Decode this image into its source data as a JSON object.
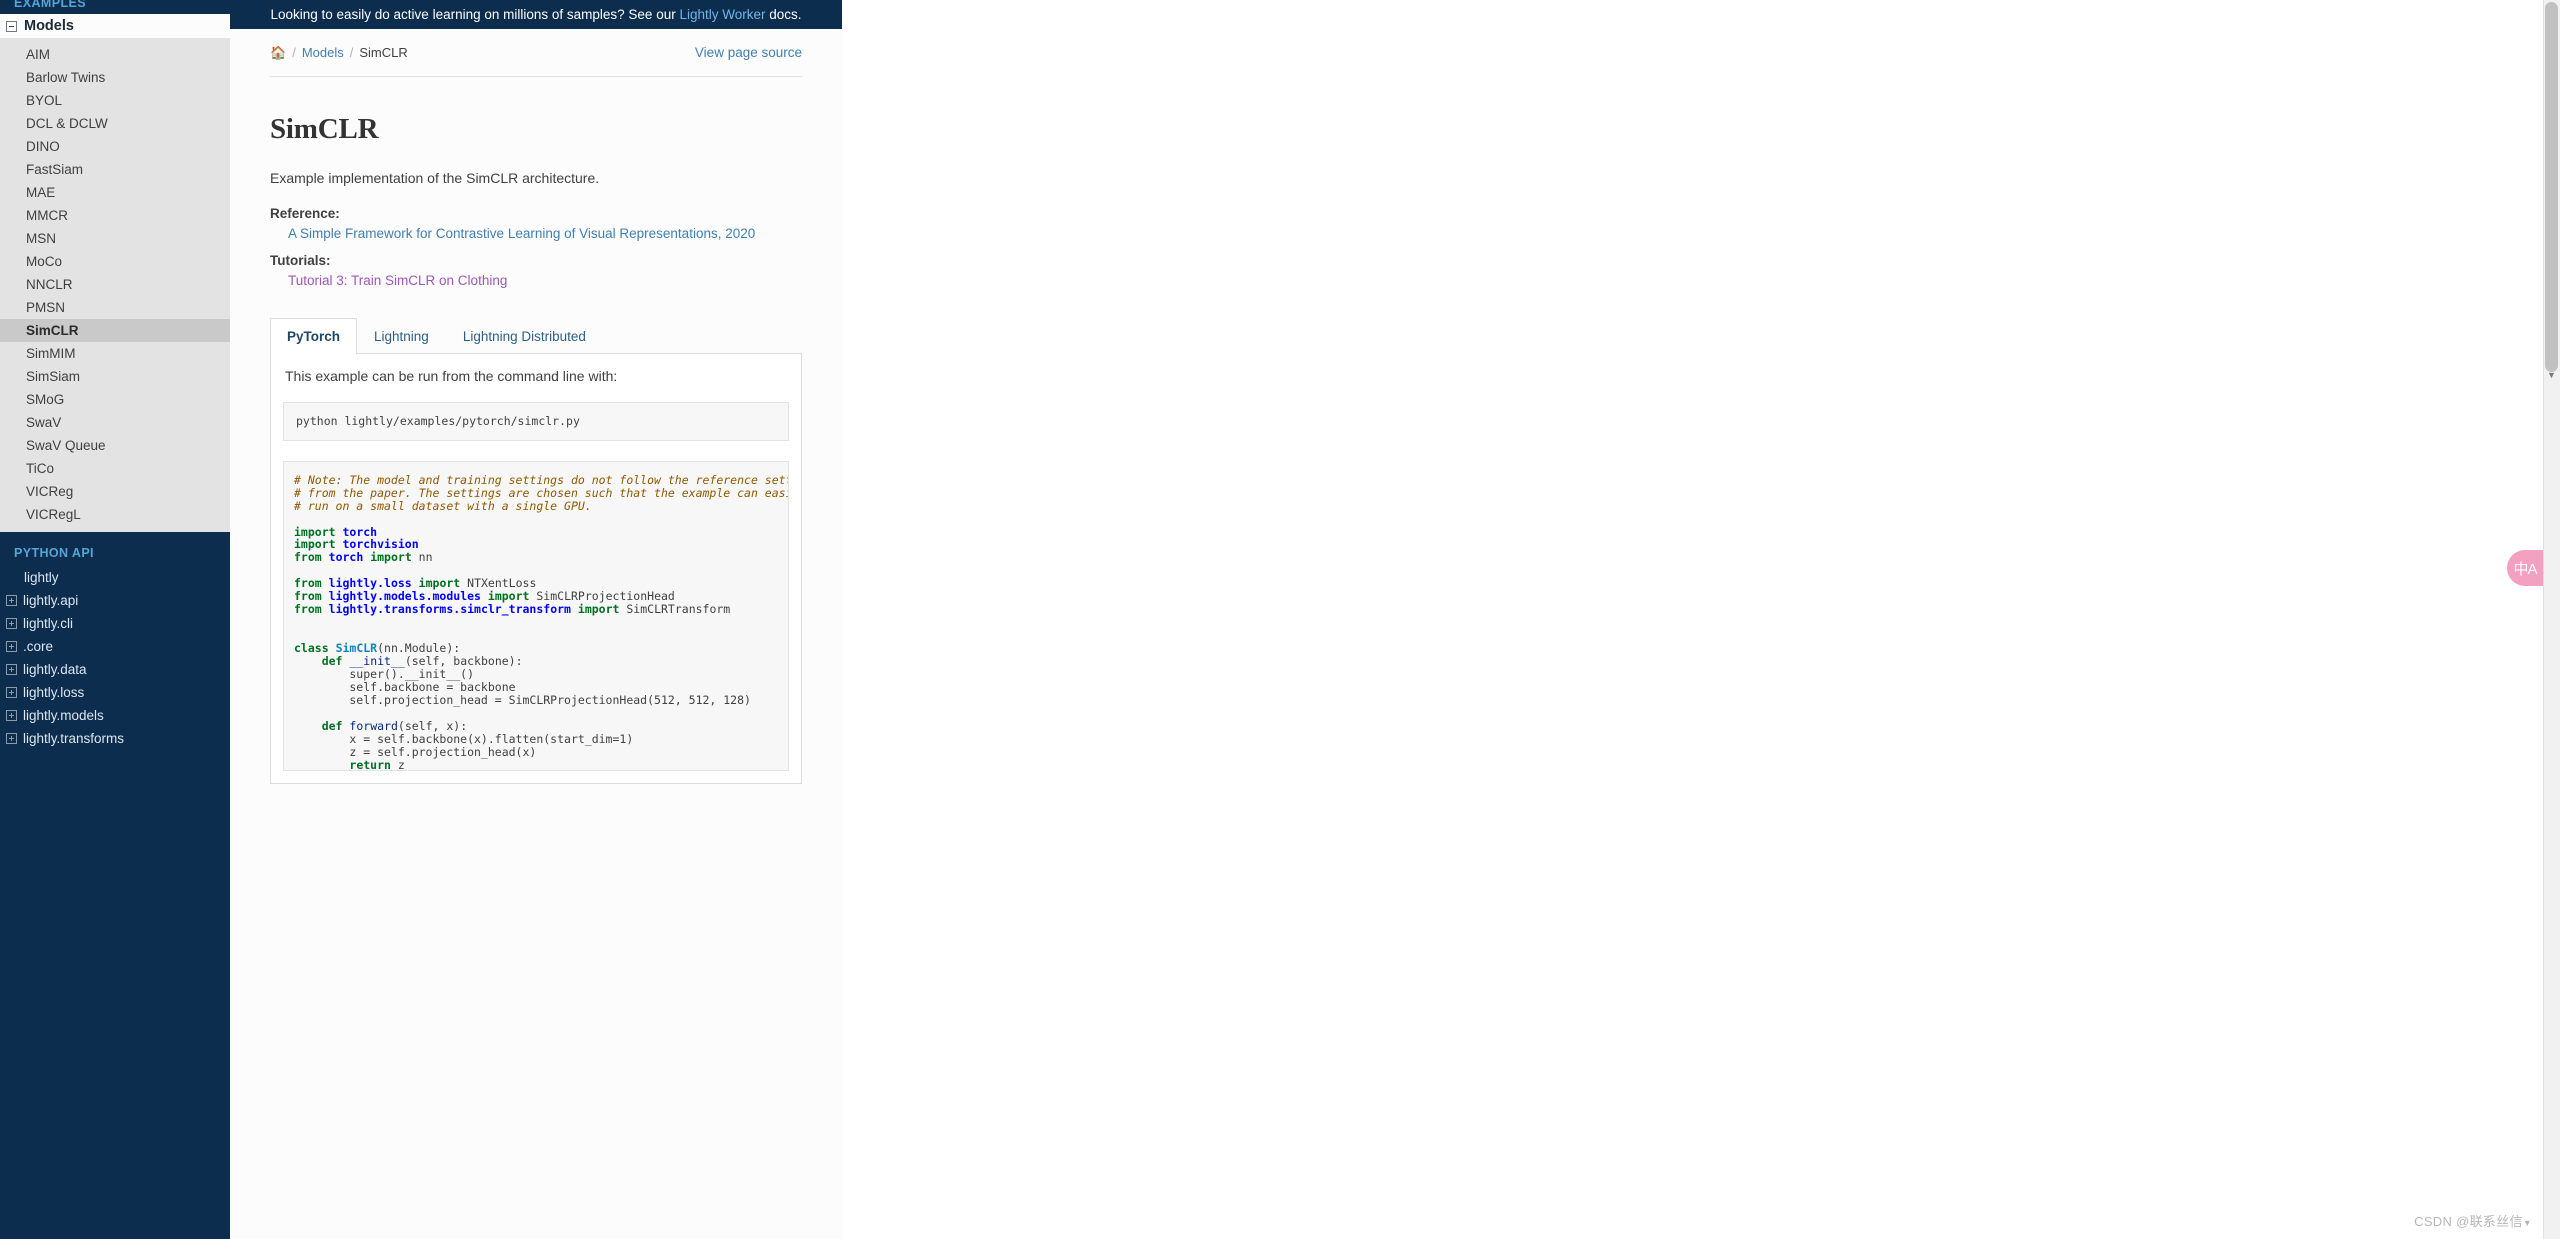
{
  "banner": {
    "text_before": "Looking to easily do active learning on millions of samples? See our ",
    "link_label": "Lightly Worker",
    "text_after": " docs."
  },
  "sidebar": {
    "captions": {
      "examples": "EXAMPLES",
      "python_api": "PYTHON API"
    },
    "models_header": "Models",
    "models": [
      {
        "label": "AIM",
        "active": false
      },
      {
        "label": "Barlow Twins",
        "active": false
      },
      {
        "label": "BYOL",
        "active": false
      },
      {
        "label": "DCL & DCLW",
        "active": false
      },
      {
        "label": "DINO",
        "active": false
      },
      {
        "label": "FastSiam",
        "active": false
      },
      {
        "label": "MAE",
        "active": false
      },
      {
        "label": "MMCR",
        "active": false
      },
      {
        "label": "MSN",
        "active": false
      },
      {
        "label": "MoCo",
        "active": false
      },
      {
        "label": "NNCLR",
        "active": false
      },
      {
        "label": "PMSN",
        "active": false
      },
      {
        "label": "SimCLR",
        "active": true
      },
      {
        "label": "SimMIM",
        "active": false
      },
      {
        "label": "SimSiam",
        "active": false
      },
      {
        "label": "SMoG",
        "active": false
      },
      {
        "label": "SwaV",
        "active": false
      },
      {
        "label": "SwaV Queue",
        "active": false
      },
      {
        "label": "TiCo",
        "active": false
      },
      {
        "label": "VICReg",
        "active": false
      },
      {
        "label": "VICRegL",
        "active": false
      }
    ],
    "python_api": [
      {
        "label": "lightly",
        "expandable": false
      },
      {
        "label": "lightly.api",
        "expandable": true
      },
      {
        "label": "lightly.cli",
        "expandable": true
      },
      {
        "label": ".core",
        "expandable": true
      },
      {
        "label": "lightly.data",
        "expandable": true
      },
      {
        "label": "lightly.loss",
        "expandable": true
      },
      {
        "label": "lightly.models",
        "expandable": true
      },
      {
        "label": "lightly.transforms",
        "expandable": true
      }
    ]
  },
  "breadcrumb": {
    "home_icon": "home-icon",
    "items": [
      {
        "label": "Models",
        "link": true
      },
      {
        "label": "SimCLR",
        "link": false
      }
    ],
    "separator": "/",
    "view_source": "View page source"
  },
  "main": {
    "title": "SimCLR",
    "description": "Example implementation of the SimCLR architecture.",
    "reference_label": "Reference:",
    "reference_link": "A Simple Framework for Contrastive Learning of Visual Representations, 2020",
    "tutorials_label": "Tutorials:",
    "tutorial_link": "Tutorial 3: Train SimCLR on Clothing",
    "tabs": [
      {
        "label": "PyTorch",
        "active": true
      },
      {
        "label": "Lightning",
        "active": false
      },
      {
        "label": "Lightning Distributed",
        "active": false
      }
    ],
    "panel_intro": "This example can be run from the command line with:",
    "command": "python lightly/examples/pytorch/simclr.py",
    "code_lines": [
      {
        "t": "cm",
        "text": "# Note: The model and training settings do not follow the reference settings"
      },
      {
        "t": "cm",
        "text": "# from the paper. The settings are chosen such that the example can easily be"
      },
      {
        "t": "cm",
        "text": "# run on a small dataset with a single GPU."
      },
      {
        "t": "blank",
        "text": ""
      },
      {
        "t": "import",
        "kw": "import",
        "mod": "torch",
        "rest": ""
      },
      {
        "t": "import",
        "kw": "import",
        "mod": "torchvision",
        "rest": ""
      },
      {
        "t": "from",
        "kw1": "from",
        "mod": "torch",
        "kw2": "import",
        "rest": " nn"
      },
      {
        "t": "blank",
        "text": ""
      },
      {
        "t": "from",
        "kw1": "from",
        "mod": "lightly.loss",
        "kw2": "import",
        "rest": " NTXentLoss"
      },
      {
        "t": "from",
        "kw1": "from",
        "mod": "lightly.models.modules",
        "kw2": "import",
        "rest": " SimCLRProjectionHead"
      },
      {
        "t": "from",
        "kw1": "from",
        "mod": "lightly.transforms.simclr_transform",
        "kw2": "import",
        "rest": " SimCLRTransform"
      },
      {
        "t": "blank",
        "text": ""
      },
      {
        "t": "blank",
        "text": ""
      },
      {
        "t": "classdef",
        "kw": "class",
        "name": "SimCLR",
        "rest": "(nn.Module):"
      },
      {
        "t": "defline",
        "indent": "    ",
        "kw": "def",
        "name": "__init__",
        "rest": "(self, backbone):"
      },
      {
        "t": "plain",
        "text": "        super().__init__()"
      },
      {
        "t": "plain",
        "text": "        self.backbone = backbone"
      },
      {
        "t": "plain",
        "text": "        self.projection_head = SimCLRProjectionHead(512, 512, 128)"
      },
      {
        "t": "blank",
        "text": ""
      },
      {
        "t": "defline",
        "indent": "    ",
        "kw": "def",
        "name": "forward",
        "rest": "(self, x):"
      },
      {
        "t": "plain",
        "text": "        x = self.backbone(x).flatten(start_dim=1)"
      },
      {
        "t": "plain",
        "text": "        z = self.projection_head(x)"
      },
      {
        "t": "return",
        "indent": "        ",
        "kw": "return",
        "rest": " z"
      }
    ]
  },
  "widgets": {
    "translate_glyph": "中A",
    "watermark": "CSDN @联系丝信"
  },
  "colors": {
    "sidebar_bg": "#0d2d4e",
    "sidebar_caption": "#55a5d9",
    "models_bg": "#e3e3e3",
    "active_item_bg": "#c9c9c9",
    "link_blue": "#3f7fb2",
    "link_purple": "#9b59b6",
    "banner_link": "#6cb7e8",
    "code_keyword": "#007020",
    "code_module": "#0000ff",
    "code_comment": "#8f5902",
    "translate_fab": "#f4a0c0"
  }
}
